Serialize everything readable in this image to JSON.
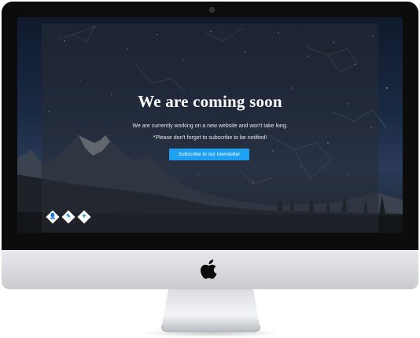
{
  "screen": {
    "title": "We are coming soon",
    "message_line1": "We are currently working on a new website and won't take long.",
    "message_line2": "*Please don't forget to subscribe to be notified!",
    "subscribe_label": "Subscribe to our newsletter"
  },
  "social": [
    {
      "icon": "user-icon",
      "glyph": "👤"
    },
    {
      "icon": "pencil-icon",
      "glyph": "✎"
    },
    {
      "icon": "twitter-icon",
      "glyph": "✈"
    }
  ],
  "colors": {
    "button": "#1ea1f2",
    "overlay": "#282c34",
    "bezel": "#0c0c0d",
    "chin": "#c9cbcf"
  }
}
